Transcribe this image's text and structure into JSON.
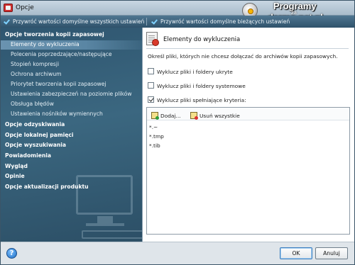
{
  "window": {
    "title": "Opcje"
  },
  "watermark": {
    "line1": "Programy",
    "za": "za",
    "line2": "darmo.net.pl"
  },
  "toolbar": {
    "restore_all": "Przywróć wartości domyślne wszystkich ustawień",
    "restore_current": "Przywróć wartości domyślne bieżących ustawień"
  },
  "sidebar": {
    "items": [
      {
        "label": "Opcje tworzenia kopii zapasowej",
        "kind": "category"
      },
      {
        "label": "Elementy do wykluczenia",
        "kind": "sub",
        "selected": true
      },
      {
        "label": "Polecenia poprzedzające/następujące",
        "kind": "sub"
      },
      {
        "label": "Stopień kompresji",
        "kind": "sub"
      },
      {
        "label": "Ochrona archiwum",
        "kind": "sub"
      },
      {
        "label": "Priorytet tworzenia kopii zapasowej",
        "kind": "sub"
      },
      {
        "label": "Ustawienia zabezpieczeń na poziomie plików",
        "kind": "sub"
      },
      {
        "label": "Obsługa błędów",
        "kind": "sub"
      },
      {
        "label": "Ustawienia nośników wymiennych",
        "kind": "sub"
      },
      {
        "label": "Opcje odzyskiwania",
        "kind": "category"
      },
      {
        "label": "Opcje lokalnej pamięci",
        "kind": "category"
      },
      {
        "label": "Opcje wyszukiwania",
        "kind": "category"
      },
      {
        "label": "Powiadomienia",
        "kind": "category"
      },
      {
        "label": "Wygląd",
        "kind": "category"
      },
      {
        "label": "Opinie",
        "kind": "category"
      },
      {
        "label": "Opcje aktualizacji produktu",
        "kind": "category"
      }
    ]
  },
  "main": {
    "heading": "Elementy do wykluczenia",
    "description": "Określ pliki, których nie chcesz dołączać do archiwów kopii zapasowych.",
    "checkboxes": [
      {
        "label": "Wyklucz pliki i foldery ukryte",
        "checked": false
      },
      {
        "label": "Wyklucz pliki i foldery systemowe",
        "checked": false
      },
      {
        "label": "Wyklucz pliki spełniające kryteria:",
        "checked": true
      }
    ],
    "filter_toolbar": {
      "add_label": "Dodaj...",
      "remove_all_label": "Usuń wszystkie"
    },
    "filters": [
      "*.~",
      "*.tmp",
      "*.tib"
    ]
  },
  "footer": {
    "help_icon": "?",
    "ok_label": "OK",
    "cancel_label": "Anuluj"
  },
  "colors": {
    "sidebar": "#3b6780",
    "toolbar": "#2f526b",
    "selected": "#6a93b0"
  }
}
